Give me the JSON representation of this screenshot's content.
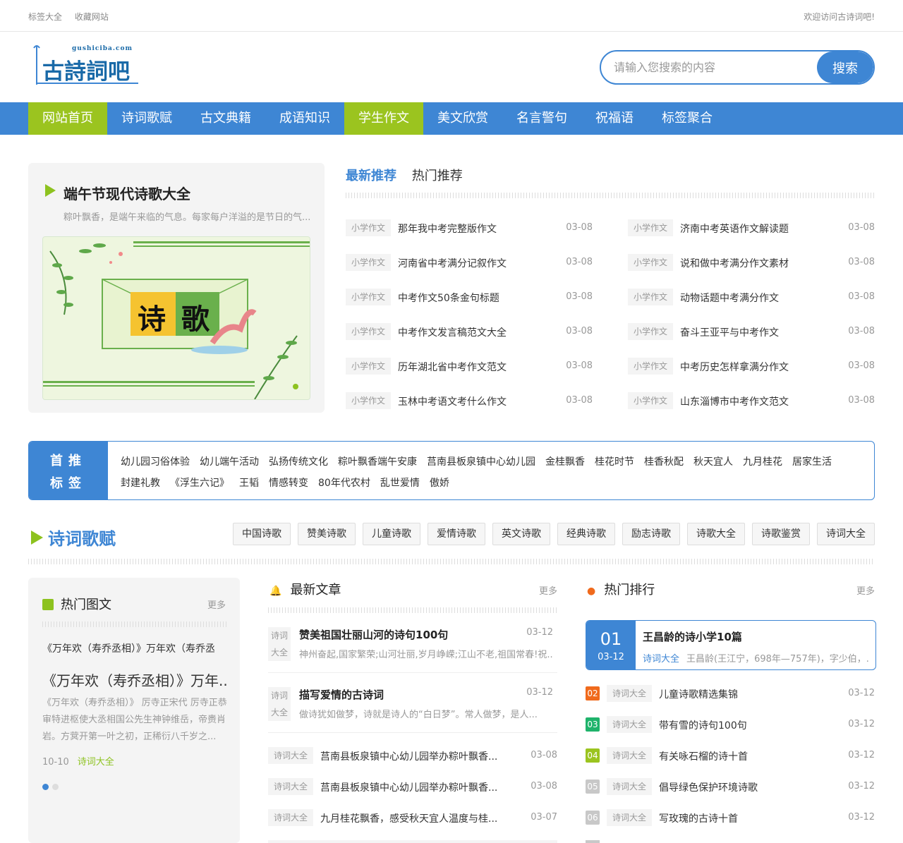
{
  "topbar": {
    "links": [
      "标签大全",
      "收藏网站"
    ],
    "welcome": "欢迎访问古诗词吧!"
  },
  "logo": {
    "text": "古詩詞吧",
    "domain": "gushiciba.com"
  },
  "search": {
    "placeholder": "请输入您搜索的内容",
    "button": "搜索"
  },
  "nav": [
    {
      "label": "网站首页",
      "active": true
    },
    {
      "label": "诗词歌赋",
      "active": false
    },
    {
      "label": "古文典籍",
      "active": false
    },
    {
      "label": "成语知识",
      "active": false
    },
    {
      "label": "学生作文",
      "active": true
    },
    {
      "label": "美文欣赏",
      "active": false
    },
    {
      "label": "名言警句",
      "active": false
    },
    {
      "label": "祝福语",
      "active": false
    },
    {
      "label": "标签聚合",
      "active": false
    }
  ],
  "featured": {
    "title": "端午节现代诗歌大全",
    "summary": "粽叶飘香，是端午来临的气息。每家每户洋溢的是节日的气...",
    "image_text": [
      "诗",
      "歌"
    ]
  },
  "tabs": {
    "latest": "最新推荐",
    "hot": "热门推荐"
  },
  "recommend": {
    "left": [
      {
        "tag": "小学作文",
        "title": "那年我中考完整版作文",
        "date": "03-08"
      },
      {
        "tag": "小学作文",
        "title": "河南省中考满分记叙作文",
        "date": "03-08"
      },
      {
        "tag": "小学作文",
        "title": "中考作文50条金句标题",
        "date": "03-08"
      },
      {
        "tag": "小学作文",
        "title": "中考作文发言稿范文大全",
        "date": "03-08"
      },
      {
        "tag": "小学作文",
        "title": "历年湖北省中考作文范文",
        "date": "03-08"
      },
      {
        "tag": "小学作文",
        "title": "玉林中考语文考什么作文",
        "date": "03-08"
      }
    ],
    "right": [
      {
        "tag": "小学作文",
        "title": "济南中考英语作文解读题",
        "date": "03-08"
      },
      {
        "tag": "小学作文",
        "title": "说和做中考满分作文素材",
        "date": "03-08"
      },
      {
        "tag": "小学作文",
        "title": "动物话题中考满分作文",
        "date": "03-08"
      },
      {
        "tag": "小学作文",
        "title": "奋斗王亚平与中考作文",
        "date": "03-08"
      },
      {
        "tag": "小学作文",
        "title": "中考历史怎样拿满分作文",
        "date": "03-08"
      },
      {
        "tag": "小学作文",
        "title": "山东淄博市中考作文范文",
        "date": "03-08"
      }
    ]
  },
  "tags_box": {
    "heading": [
      "首推",
      "标签"
    ],
    "tags": [
      "幼儿园习俗体验",
      "幼儿端午活动",
      "弘扬传统文化",
      "粽叶飘香端午安康",
      "莒南县板泉镇中心幼儿园",
      "金桂飘香",
      "桂花时节",
      "桂香秋配",
      "秋天宜人",
      "九月桂花",
      "居家生活",
      "封建礼教",
      "《浮生六记》",
      "王韬",
      "情感转变",
      "80年代农村",
      "乱世爱情",
      "傲娇"
    ]
  },
  "section": {
    "title": "诗词歌赋",
    "pills": [
      "中国诗歌",
      "赞美诗歌",
      "儿童诗歌",
      "爱情诗歌",
      "英文诗歌",
      "经典诗歌",
      "励志诗歌",
      "诗歌大全",
      "诗歌鉴赏",
      "诗词大全"
    ]
  },
  "hot_pics": {
    "title": "热门图文",
    "more": "更多",
    "line1": "《万年欢（寿乔丞相）》万年欢（寿乔丞",
    "title2": "《万年欢（寿乔丞相）》万年...",
    "summary": "《万年欢（寿乔丞相）》 厉寺正宋代 厉寺正恭审特进枢使大丞相国公先生神钟维岳，帝赉肖岩。方蓂开第一叶之初，正稀衍八千岁之...",
    "date": "10-10",
    "category": "诗词大全"
  },
  "latest": {
    "title": "最新文章",
    "more": "更多",
    "blocks": [
      {
        "tag": "诗词大全",
        "title": "赞美祖国壮丽山河的诗句100句",
        "date": "03-12",
        "summary": "神州奋起,国家繁荣;山河壮丽,岁月峥嵘;江山不老,祖国常春!祝..."
      },
      {
        "tag": "诗词大全",
        "title": "描写爱情的古诗词",
        "date": "03-12",
        "summary": "做诗犹如做梦，诗就是诗人的“白日梦”。常人做梦，是人..."
      }
    ],
    "rows": [
      {
        "tag": "诗词大全",
        "title": "莒南县板泉镇中心幼儿园举办粽叶飘香...",
        "date": "03-08"
      },
      {
        "tag": "诗词大全",
        "title": "莒南县板泉镇中心幼儿园举办粽叶飘香...",
        "date": "03-08"
      },
      {
        "tag": "诗词大全",
        "title": "九月桂花飘香，感受秋天宜人温度与桂...",
        "date": "03-07"
      }
    ]
  },
  "ranking": {
    "title": "热门排行",
    "more": "更多",
    "top": {
      "num": "01",
      "date": "03-12",
      "title": "王昌龄的诗小学10篇",
      "category": "诗词大全",
      "summary": "王昌龄(王江宁，698年—757年)，字少伯，..."
    },
    "rows": [
      {
        "num": "02",
        "color": "#f06a1c",
        "tag": "诗词大全",
        "title": "儿童诗歌精选集锦",
        "date": "03-12"
      },
      {
        "num": "03",
        "color": "#1fb36b",
        "tag": "诗词大全",
        "title": "带有雪的诗句100句",
        "date": "03-12"
      },
      {
        "num": "04",
        "color": "#9bc41f",
        "tag": "诗词大全",
        "title": "有关咏石榴的诗十首",
        "date": "03-12"
      },
      {
        "num": "05",
        "color": "#c8c8c8",
        "tag": "诗词大全",
        "title": "倡导绿色保护环境诗歌",
        "date": "03-12"
      },
      {
        "num": "06",
        "color": "#c8c8c8",
        "tag": "诗词大全",
        "title": "写玫瑰的古诗十首",
        "date": "03-12"
      }
    ]
  },
  "colors": {
    "blue": "#3e86d4",
    "green": "#9bc41f"
  }
}
